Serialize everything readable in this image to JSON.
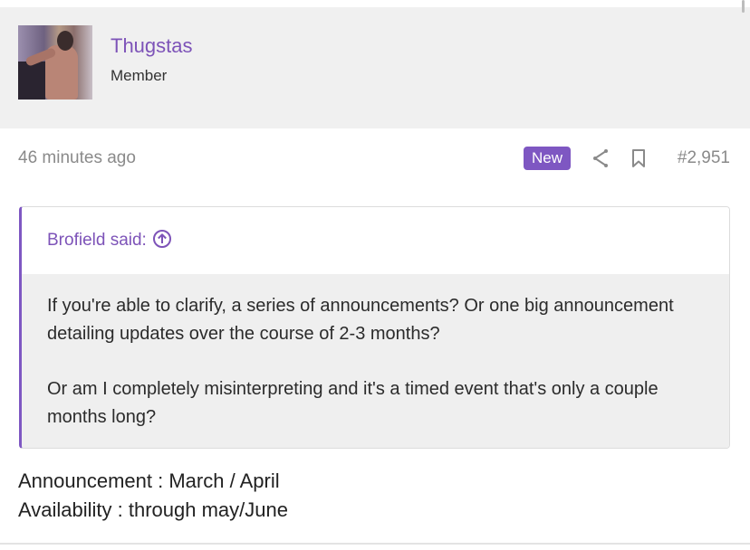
{
  "author": {
    "username": "Thugstas",
    "title": "Member",
    "avatar_icon": "user-avatar-photo"
  },
  "post_meta": {
    "time": "46 minutes ago",
    "badge": "New",
    "share_icon": "share-icon",
    "bookmark_icon": "bookmark-icon",
    "post_number": "#2,951"
  },
  "quote": {
    "author_line": "Brofield said:",
    "jump_icon": "arrow-up-circle-icon",
    "paragraphs": [
      "If you're able to clarify, a series of announcements? Or one big announcement detailing updates over the course of 2-3 months?",
      "Or am I completely misinterpreting and it's a timed event that's only a couple months long?"
    ]
  },
  "post_body": {
    "lines": [
      "Announcement : March / April",
      "Availability : through may/June"
    ]
  },
  "colors": {
    "accent": "#7e57c2",
    "author_bg": "#f0f0f0",
    "quote_body_bg": "#efefef",
    "meta_text": "#8a8a8a"
  }
}
